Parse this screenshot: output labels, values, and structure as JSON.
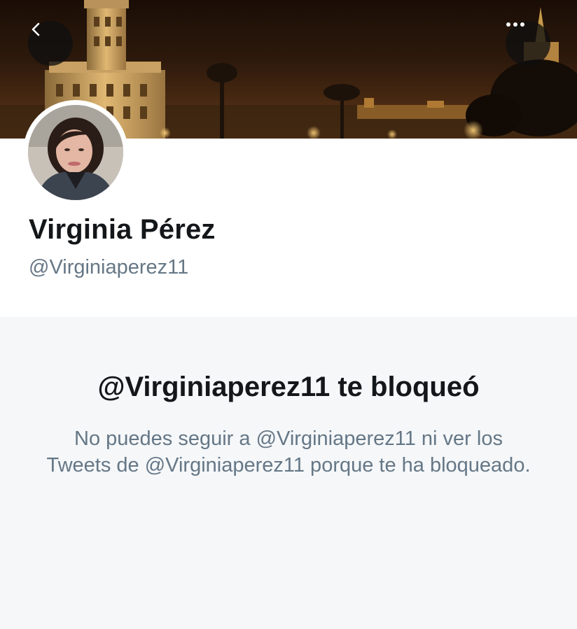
{
  "header": {
    "back_icon": "chevron-left-icon",
    "more_icon": "more-horizontal-icon"
  },
  "profile": {
    "name": "Virginia Pérez",
    "handle": "@Virginiaperez11"
  },
  "blocked": {
    "title": "@Virginiaperez11 te bloqueó",
    "message": "No puedes seguir a @Virginiaperez11 ni ver los Tweets de @Virginiaperez11 porque te ha bloqueado."
  },
  "colors": {
    "name_text": "#14171a",
    "secondary_text": "#657786",
    "panel_background": "#f5f7f9"
  }
}
